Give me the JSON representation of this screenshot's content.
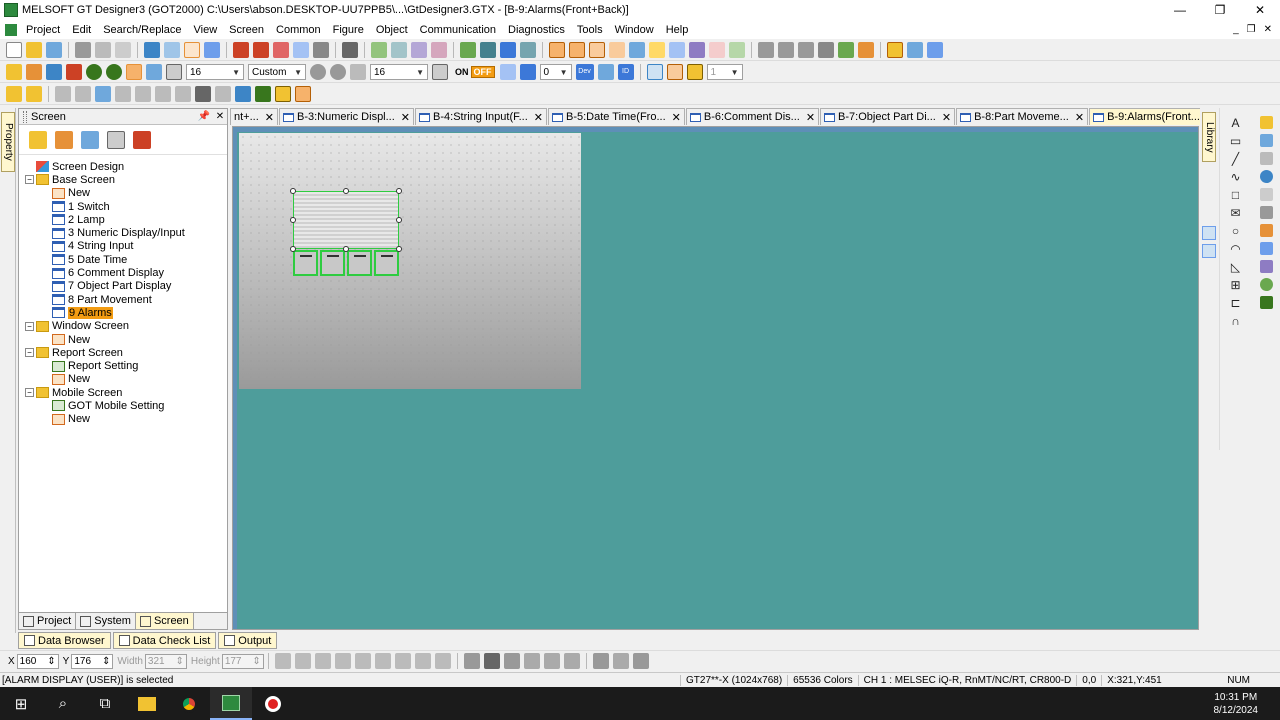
{
  "window": {
    "title": "MELSOFT GT Designer3 (GOT2000) C:\\Users\\abson.DESKTOP-UU7PPB5\\...\\GtDesigner3.GTX - [B-9:Alarms(Front+Back)]",
    "minimize": "—",
    "restore": "❐",
    "close": "✕"
  },
  "menu": [
    "Project",
    "Edit",
    "Search/Replace",
    "View",
    "Screen",
    "Common",
    "Figure",
    "Object",
    "Communication",
    "Diagnostics",
    "Tools",
    "Window",
    "Help"
  ],
  "mdi_controls": [
    "_",
    "❐",
    "✕"
  ],
  "toolbar2": {
    "font_size": "16",
    "style": "Custom",
    "grid": "16",
    "on_label": "ON",
    "off_label": "OFF",
    "zero_value": "0",
    "dev_label": "Dev",
    "id_label": "ID",
    "one_value": "1"
  },
  "screen_panel": {
    "title": "Screen",
    "pin": "📌",
    "close": "✕",
    "tree": [
      {
        "level": 0,
        "expander": "",
        "icon": "design",
        "label": "Screen Design"
      },
      {
        "level": 0,
        "expander": "−",
        "icon": "folder",
        "label": "Base Screen"
      },
      {
        "level": 1,
        "expander": "",
        "icon": "new",
        "label": "New"
      },
      {
        "level": 1,
        "expander": "",
        "icon": "screen",
        "label": "1 Switch"
      },
      {
        "level": 1,
        "expander": "",
        "icon": "screen",
        "label": "2 Lamp"
      },
      {
        "level": 1,
        "expander": "",
        "icon": "screen",
        "label": "3 Numeric Display/Input"
      },
      {
        "level": 1,
        "expander": "",
        "icon": "screen",
        "label": "4 String Input"
      },
      {
        "level": 1,
        "expander": "",
        "icon": "screen",
        "label": "5 Date Time"
      },
      {
        "level": 1,
        "expander": "",
        "icon": "screen",
        "label": "6 Comment Display"
      },
      {
        "level": 1,
        "expander": "",
        "icon": "screen",
        "label": "7 Object Part Display"
      },
      {
        "level": 1,
        "expander": "",
        "icon": "screen",
        "label": "8 Part Movement"
      },
      {
        "level": 1,
        "expander": "",
        "icon": "screen",
        "label": "9 Alarms",
        "selected": true
      },
      {
        "level": 0,
        "expander": "−",
        "icon": "folder",
        "label": "Window Screen"
      },
      {
        "level": 1,
        "expander": "",
        "icon": "new",
        "label": "New"
      },
      {
        "level": 0,
        "expander": "−",
        "icon": "folder",
        "label": "Report Screen"
      },
      {
        "level": 1,
        "expander": "",
        "icon": "setting",
        "label": "Report Setting"
      },
      {
        "level": 1,
        "expander": "",
        "icon": "new",
        "label": "New"
      },
      {
        "level": 0,
        "expander": "−",
        "icon": "folder",
        "label": "Mobile Screen"
      },
      {
        "level": 1,
        "expander": "",
        "icon": "setting",
        "label": "GOT Mobile Setting"
      },
      {
        "level": 1,
        "expander": "",
        "icon": "new",
        "label": "New"
      }
    ],
    "bottom_tabs": [
      "Project",
      "System",
      "Screen"
    ]
  },
  "left_vtab": "Property",
  "right_vtab": "Library",
  "doc_tabs": [
    {
      "label": "nt+...",
      "active": false
    },
    {
      "label": "B-3:Numeric Displ...",
      "active": false
    },
    {
      "label": "B-4:String Input(F...",
      "active": false
    },
    {
      "label": "B-5:Date Time(Fro...",
      "active": false
    },
    {
      "label": "B-6:Comment Dis...",
      "active": false
    },
    {
      "label": "B-7:Object Part Di...",
      "active": false
    },
    {
      "label": "B-8:Part Moveme...",
      "active": false
    },
    {
      "label": "B-9:Alarms(Front...",
      "active": true
    }
  ],
  "doc_tab_close": "✕",
  "doc_nav": [
    "◀",
    "▶",
    "▼",
    "✕"
  ],
  "right_tools": [
    "A",
    "▭",
    "╱",
    "∿",
    "□",
    "✉",
    "○",
    "◠",
    "◺",
    "⊞",
    "⊏",
    "∩"
  ],
  "bottom_tabs": [
    "Data Browser",
    "Data Check List",
    "Output"
  ],
  "coords": {
    "x_label": "X",
    "x_value": "160",
    "y_label": "Y",
    "y_value": "176",
    "width_label": "Width",
    "width_value": "321",
    "height_label": "Height",
    "height_value": "177"
  },
  "status": {
    "message": "[ALARM DISPLAY (USER)] is selected",
    "model": "GT27**-X (1024x768)",
    "colors": "65536 Colors",
    "channel": "CH 1 : MELSEC iQ-R, RnMT/NC/RT, CR800-D",
    "offset": "0,0",
    "cursor_pos": "X:321,Y:451",
    "num": "NUM"
  },
  "taskbar": {
    "start_icon": "⊞",
    "search_icon": "⌕",
    "taskview_icon": "⧉",
    "time": "10:31 PM",
    "date": "8/12/2024"
  },
  "colors": {
    "editor_bg": "#4e9d9b",
    "selection": "#f39c12",
    "object_outline": "#2ecc40"
  }
}
